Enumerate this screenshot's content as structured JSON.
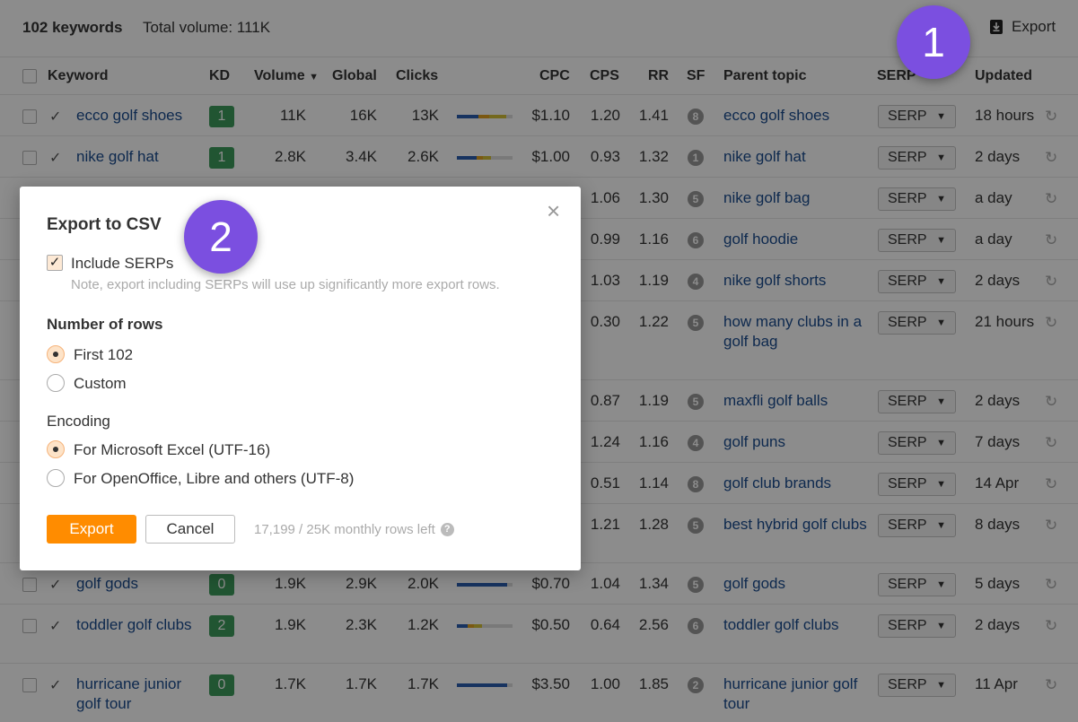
{
  "header": {
    "keyword_count": "102 keywords",
    "total_volume": "Total volume: 111K",
    "export_label": "Export"
  },
  "columns": {
    "keyword": "Keyword",
    "kd": "KD",
    "volume": "Volume",
    "volume_sort_icon": "caret-down",
    "global": "Global",
    "clicks": "Clicks",
    "cpc": "CPC",
    "cps": "CPS",
    "rr": "RR",
    "sf": "SF",
    "parent_topic": "Parent topic",
    "serp": "SERP",
    "updated": "Updated"
  },
  "rows": [
    {
      "keyword": "ecco golf shoes",
      "kd": "1",
      "volume": "11K",
      "global": "16K",
      "clicks": "13K",
      "cpc": "$1.10",
      "cps": "1.20",
      "rr": "1.41",
      "sf": "8",
      "parent_topic": "ecco golf shoes",
      "serp": "SERP",
      "updated": "18 hours"
    },
    {
      "keyword": "nike golf hat",
      "kd": "1",
      "volume": "2.8K",
      "global": "3.4K",
      "clicks": "2.6K",
      "cpc": "$1.00",
      "cps": "0.93",
      "rr": "1.32",
      "sf": "1",
      "parent_topic": "nike golf hat",
      "serp": "SERP",
      "updated": "2 days"
    },
    {
      "cps": "1.06",
      "rr": "1.30",
      "sf": "5",
      "parent_topic": "nike golf bag",
      "serp": "SERP",
      "updated": "a day"
    },
    {
      "cps": "0.99",
      "rr": "1.16",
      "sf": "6",
      "parent_topic": "golf hoodie",
      "serp": "SERP",
      "updated": "a day"
    },
    {
      "cps": "1.03",
      "rr": "1.19",
      "sf": "4",
      "parent_topic": "nike golf shorts",
      "serp": "SERP",
      "updated": "2 days"
    },
    {
      "cps": "0.30",
      "rr": "1.22",
      "sf": "5",
      "parent_topic": "how many clubs in a golf bag",
      "serp": "SERP",
      "updated": "21 hours"
    },
    {
      "cps": "0.87",
      "rr": "1.19",
      "sf": "5",
      "parent_topic": "maxfli golf balls",
      "serp": "SERP",
      "updated": "2 days"
    },
    {
      "cps": "1.24",
      "rr": "1.16",
      "sf": "4",
      "parent_topic": "golf puns",
      "serp": "SERP",
      "updated": "7 days"
    },
    {
      "cps": "0.51",
      "rr": "1.14",
      "sf": "8",
      "parent_topic": "golf club brands",
      "serp": "SERP",
      "updated": "14 Apr"
    },
    {
      "cps": "1.21",
      "rr": "1.28",
      "sf": "5",
      "parent_topic": "best hybrid golf clubs",
      "serp": "SERP",
      "updated": "8 days"
    },
    {
      "keyword": "golf gods",
      "kd": "0",
      "volume": "1.9K",
      "global": "2.9K",
      "clicks": "2.0K",
      "cpc": "$0.70",
      "cps": "1.04",
      "rr": "1.34",
      "sf": "5",
      "parent_topic": "golf gods",
      "serp": "SERP",
      "updated": "5 days"
    },
    {
      "keyword": "toddler golf clubs",
      "kd": "2",
      "volume": "1.9K",
      "global": "2.3K",
      "clicks": "1.2K",
      "cpc": "$0.50",
      "cps": "0.64",
      "rr": "2.56",
      "sf": "6",
      "parent_topic": "toddler golf clubs",
      "serp": "SERP",
      "updated": "2 days"
    },
    {
      "keyword": "hurricane junior golf tour",
      "kd": "0",
      "volume": "1.7K",
      "global": "1.7K",
      "clicks": "1.7K",
      "cpc": "$3.50",
      "cps": "1.00",
      "rr": "1.85",
      "sf": "2",
      "parent_topic": "hurricane junior golf tour",
      "serp": "SERP",
      "updated": "11 Apr"
    }
  ],
  "clicks_bars": [
    [
      {
        "pct": 0.38,
        "color": "#2a5db0"
      },
      {
        "pct": 0.2,
        "color": "#e0a020"
      },
      {
        "pct": 0.3,
        "color": "#d4c038"
      }
    ],
    [
      {
        "pct": 0.35,
        "color": "#2a5db0"
      },
      {
        "pct": 0.12,
        "color": "#e0a020"
      },
      {
        "pct": 0.15,
        "color": "#d4c038"
      }
    ],
    [
      {
        "pct": 0.9,
        "color": "#2a5db0"
      }
    ],
    [
      {
        "pct": 0.2,
        "color": "#2a5db0"
      },
      {
        "pct": 0.1,
        "color": "#e0a020"
      },
      {
        "pct": 0.15,
        "color": "#d4c038"
      }
    ],
    [
      {
        "pct": 0.9,
        "color": "#2a5db0"
      }
    ]
  ],
  "modal": {
    "title": "Export to CSV",
    "close_icon": "close-icon",
    "include_serps_label": "Include SERPs",
    "include_serps_checked": true,
    "note": "Note, export including SERPs will use up significantly more export rows.",
    "rows_heading": "Number of rows",
    "rows_options": [
      "First 102",
      "Custom"
    ],
    "rows_selected": "First 102",
    "encoding_heading": "Encoding",
    "encoding_options": [
      "For Microsoft Excel (UTF-16)",
      "For OpenOffice, Libre and others (UTF-8)"
    ],
    "encoding_selected": "For Microsoft Excel (UTF-16)",
    "export_button": "Export",
    "cancel_button": "Cancel",
    "rows_left": "17,199 / 25K monthly rows left",
    "help_icon": "?"
  },
  "steps": [
    "1",
    "2"
  ],
  "colors": {
    "accent_orange": "#ff8c00",
    "step_purple": "#7b4fe0",
    "link_blue": "#1a4c8f",
    "kd_green": "#3d9b5c"
  }
}
